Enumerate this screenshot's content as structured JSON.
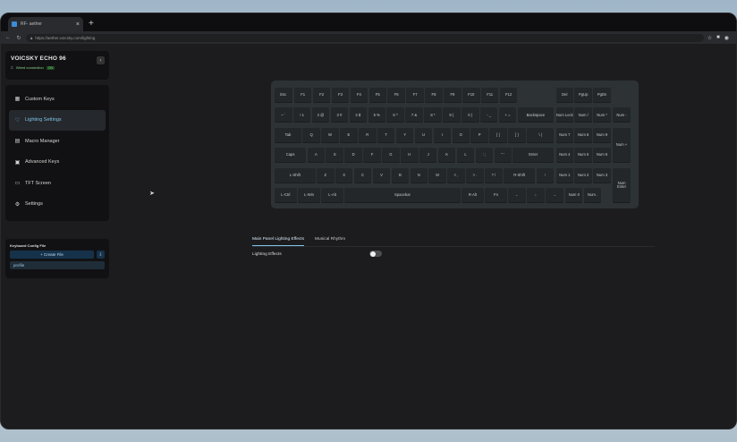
{
  "browser": {
    "tab_title": "RF- aether",
    "tab_close": "×",
    "new_tab": "+",
    "url": "https://aether.voicsky.com/lighting"
  },
  "device": {
    "name": "VOICSKY ECHO 96",
    "connection": "Wired connection",
    "connection_badge": "ON"
  },
  "sidebar": {
    "items": [
      {
        "label": "Custom Keys",
        "icon": "grid-icon"
      },
      {
        "label": "Lighting Settings",
        "icon": "bulb-icon"
      },
      {
        "label": "Macro Manager",
        "icon": "macro-icon"
      },
      {
        "label": "Advanced Keys",
        "icon": "doc-icon"
      },
      {
        "label": "TFT Screen",
        "icon": "monitor-icon"
      },
      {
        "label": "Settings",
        "icon": "gear-icon"
      }
    ]
  },
  "config": {
    "title": "Keyboard Config File",
    "create_label": "+ Create File",
    "profile": "profile"
  },
  "keyboard": {
    "keys": [
      "Esc",
      "F1",
      "F2",
      "F3",
      "F4",
      "F5",
      "F6",
      "F7",
      "F8",
      "F9",
      "F10",
      "F11",
      "F12",
      "Del",
      "PgUp",
      "PgDn",
      "~ `",
      "! 1",
      "2 @",
      "3 #",
      "4 $",
      "5 %",
      "6 ^",
      "7 &",
      "8 *",
      "9 (",
      "0 )",
      "- _",
      "+ =",
      "Backspace",
      "Num Lock",
      "Num /",
      "Num *",
      "Num -",
      "Tab",
      "Q",
      "W",
      "E",
      "R",
      "T",
      "Y",
      "U",
      "I",
      "O",
      "P",
      "[ {",
      "] }",
      "\\ |",
      "Num 7",
      "Num 8",
      "Num 9",
      "Num +",
      "Caps",
      "A",
      "S",
      "D",
      "F",
      "G",
      "H",
      "J",
      "K",
      "L",
      ": ;",
      "\" '",
      "Enter",
      "Num 4",
      "Num 5",
      "Num 6",
      "L-Shift",
      "Z",
      "X",
      "C",
      "V",
      "B",
      "N",
      "M",
      "< ,",
      "> .",
      "? /",
      "R-Shift",
      "↑",
      "Num 1",
      "Num 2",
      "Num 3",
      "Num Enter",
      "L-Ctrl",
      "L-Win",
      "L-Alt",
      "Spacebar",
      "R-Alt",
      "Fn",
      "←",
      "↓",
      "→",
      "Num 0",
      "Num ."
    ]
  },
  "panel": {
    "tabs": [
      "Main Panel Lighting Effects",
      "Musical Rhythm"
    ],
    "effects_label": "Lighting Effects",
    "effects_enabled": false
  }
}
